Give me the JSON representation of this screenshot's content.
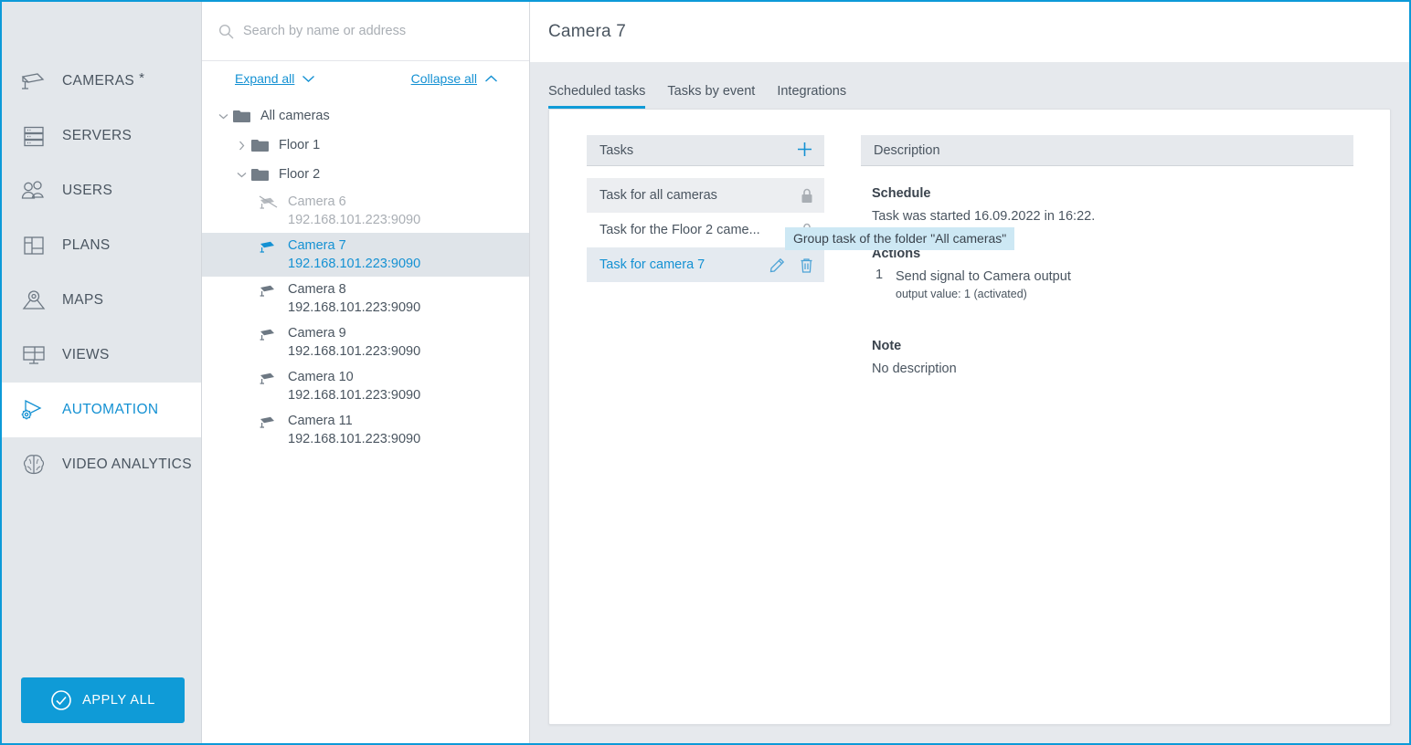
{
  "sidebar": {
    "items": [
      {
        "label": "CAMERAS",
        "icon": "camera-icon",
        "star": "*",
        "active": false
      },
      {
        "label": "SERVERS",
        "icon": "server-icon",
        "star": "",
        "active": false
      },
      {
        "label": "USERS",
        "icon": "users-icon",
        "star": "",
        "active": false
      },
      {
        "label": "PLANS",
        "icon": "plans-icon",
        "star": "",
        "active": false
      },
      {
        "label": "MAPS",
        "icon": "map-pin-icon",
        "star": "",
        "active": false
      },
      {
        "label": "VIEWS",
        "icon": "views-grid-icon",
        "star": "",
        "active": false
      },
      {
        "label": "AUTOMATION",
        "icon": "automation-gear-play-icon",
        "star": "",
        "active": true
      },
      {
        "label": "VIDEO ANALYTICS",
        "icon": "brain-icon",
        "star": "",
        "active": false
      }
    ],
    "apply_all_label": "APPLY ALL",
    "apply_all_icon": "check-circle-icon"
  },
  "tree_panel": {
    "search": {
      "placeholder": "Search by name or address",
      "value": "",
      "icon": "search-icon"
    },
    "expand_all_label": "Expand all",
    "collapse_all_label": "Collapse all",
    "root": {
      "label": "All cameras",
      "expanded": true
    },
    "folders": [
      {
        "label": "Floor 1",
        "expanded": false
      },
      {
        "label": "Floor 2",
        "expanded": true
      }
    ],
    "cameras": [
      {
        "name": "Camera 6",
        "address": "192.168.101.223:9090",
        "state": "offline",
        "selected": false
      },
      {
        "name": "Camera 7",
        "address": "192.168.101.223:9090",
        "state": "active",
        "selected": true
      },
      {
        "name": "Camera 8",
        "address": "192.168.101.223:9090",
        "state": "online",
        "selected": false
      },
      {
        "name": "Camera 9",
        "address": "192.168.101.223:9090",
        "state": "online",
        "selected": false
      },
      {
        "name": "Camera 10",
        "address": "192.168.101.223:9090",
        "state": "online",
        "selected": false
      },
      {
        "name": "Camera 11",
        "address": "192.168.101.223:9090",
        "state": "online",
        "selected": false
      }
    ]
  },
  "main": {
    "title": "Camera 7",
    "tabs": [
      {
        "label": "Scheduled tasks",
        "active": true
      },
      {
        "label": "Tasks by event",
        "active": false
      },
      {
        "label": "Integrations",
        "active": false
      }
    ],
    "tasks_panel": {
      "header": "Tasks",
      "add_icon": "plus-icon",
      "items": [
        {
          "label": "Task for all cameras",
          "locked": true,
          "shaded": true,
          "selected": false
        },
        {
          "label": "Task for the Floor 2 came...",
          "locked": true,
          "shaded": false,
          "selected": false
        },
        {
          "label": "Task for camera 7",
          "locked": false,
          "shaded": false,
          "selected": true,
          "edit_icon": "pencil-icon",
          "delete_icon": "trash-icon"
        }
      ]
    },
    "description_panel": {
      "header": "Description",
      "schedule_heading": "Schedule",
      "schedule_text": "Task was started 16.09.2022 in 16:22.",
      "actions_heading": "Actions",
      "actions": [
        {
          "num": "1",
          "title": "Send signal to Camera output",
          "sub": "output value: 1 (activated)"
        }
      ],
      "note_heading": "Note",
      "note_text": "No description"
    },
    "tooltip": "Group task of the folder \"All cameras\""
  },
  "colors": {
    "accent": "#0f9bd7",
    "link": "#1491d3",
    "text": "#4a5560",
    "panel_bg": "#e6e9ed",
    "tooltip_bg": "#cde8f4"
  }
}
